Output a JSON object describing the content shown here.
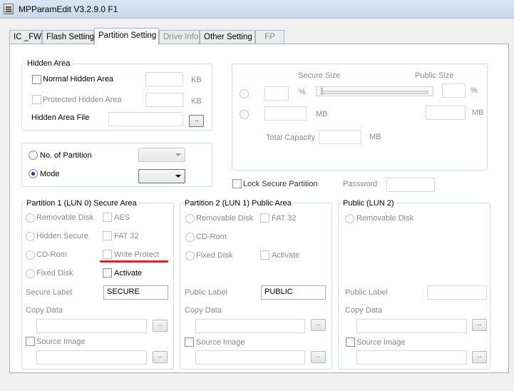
{
  "window": {
    "title": "MPParamEdit V3.2.9.0 F1"
  },
  "tabs": [
    {
      "label": "IC _FW"
    },
    {
      "label": "Flash Setting"
    },
    {
      "label": "Partition Setting"
    },
    {
      "label": "Drive Info"
    },
    {
      "label": "Other Setting"
    },
    {
      "label": "FP"
    }
  ],
  "active_tab": "Partition Setting",
  "hidden_area": {
    "title": "Hidden Area",
    "normal_label": "Normal Hidden Area",
    "protected_label": "Protected Hidden Area",
    "file_label": "Hidden Area File",
    "kb1": "KB",
    "kb2": "KB",
    "browse": ".."
  },
  "secure_size_panel": {
    "secure_size_label": "Secure Size",
    "public_size_label": "Public Size",
    "pct1": "%",
    "pct2": "%",
    "mb1": "MB",
    "mb2": "MB",
    "total_capacity_label": "Total Capacity",
    "mb3": "MB"
  },
  "partition_mode": {
    "no_of_partition_label": "No. of Partition",
    "mode_label": "Mode",
    "mode_selected": "mode"
  },
  "lock_secure": {
    "label": "Lock Secure Partition",
    "password_label": "Password"
  },
  "partition1": {
    "title": "Partition 1 (LUN 0) Secure Area",
    "removable_disk": "Removable Disk",
    "hidden_secure": "Hidden Secure",
    "cd_rom": "CD-Rom",
    "fixed_disk": "Fixed Disk",
    "aes": "AES",
    "fat32": "FAT 32",
    "write_protect": "Write Protect",
    "activate": "Activate",
    "label_caption": "Secure Label",
    "label_value": "SECURE",
    "copy_data": "Copy Data",
    "source_image": "Source Image",
    "browse": ".."
  },
  "partition2": {
    "title": "Partition 2 (LUN 1) Public Area",
    "removable_disk": "Removable Disk",
    "cd_rom": "CD-Rom",
    "fixed_disk": "Fixed Disk",
    "fat32": "FAT 32",
    "activate": "Activate",
    "label_caption": "Public Label",
    "label_value": "PUBLIC",
    "copy_data": "Copy Data",
    "source_image": "Source Image",
    "browse": ".."
  },
  "public_lun2": {
    "title": "Public (LUN 2)",
    "removable_disk": "Removable Disk",
    "label_caption": "Public Label",
    "copy_data": "Copy Data",
    "source_image": "Source Image",
    "browse": ".."
  },
  "colors": {
    "annotation_underline": "#d42020",
    "mode_radio_dot": "#1f3c6e"
  }
}
